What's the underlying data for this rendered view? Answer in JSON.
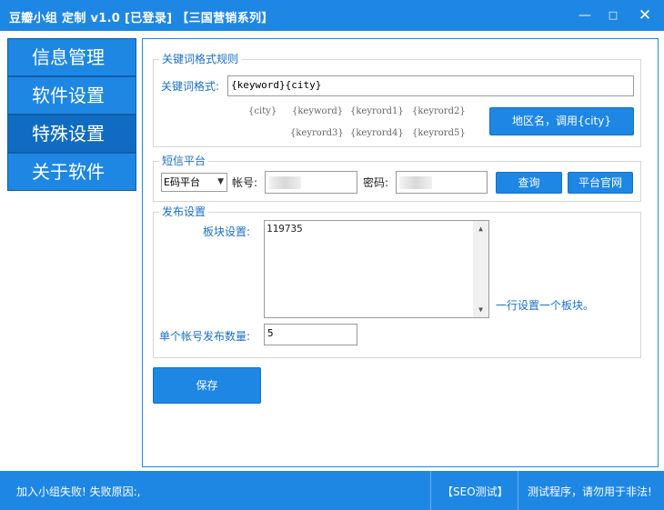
{
  "window": {
    "title": "豆瓣小组 定制 v1.0 [已登录]  【三国营销系列】",
    "minimize": "—",
    "maximize": "□",
    "close": "✕"
  },
  "nav": {
    "items": [
      {
        "label": "信息管理"
      },
      {
        "label": "软件设置"
      },
      {
        "label": "特殊设置"
      },
      {
        "label": "关于软件"
      }
    ]
  },
  "keyword_group": {
    "legend": "关键词格式规则",
    "format_label": "关键词格式:",
    "format_value": "{keyword}{city}",
    "tags_row1": [
      "{city}",
      "{keyword}",
      "{keyrord1}",
      "{keyrord2}"
    ],
    "tags_row2": [
      "{keyrord3}",
      "{keyrord4}",
      "{keyrord5}"
    ],
    "region_button": "地区名，调用{city}"
  },
  "sms_group": {
    "legend": "短信平台",
    "platform_selected": "E码平台",
    "account_label": "帐号:",
    "password_label": "密码:",
    "query_button": "查询",
    "site_button": "平台官网"
  },
  "publish_group": {
    "legend": "发布设置",
    "board_label": "板块设置:",
    "board_value": "119735",
    "board_hint": "一行设置一个板块。",
    "count_label": "单个帐号发布数量:",
    "count_value": "5"
  },
  "save_button": "保存",
  "status": {
    "left": "加入小组失败!   失败原因:,",
    "seo": "【SEO测试】",
    "right": "测试程序，请勿用于非法!"
  }
}
